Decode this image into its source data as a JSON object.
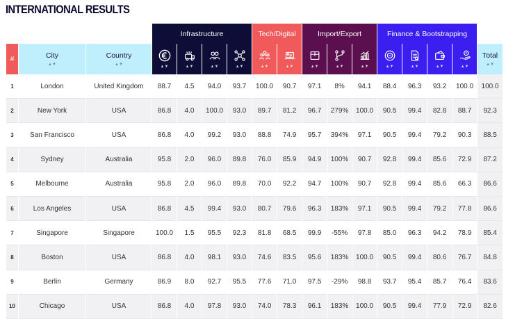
{
  "page": {
    "title": "INTERNATIONAL RESULTS"
  },
  "groups": {
    "infrastructure": "Infrastructure",
    "tech": "Tech/Digital",
    "import": "Import/Export",
    "finance": "Finance & Bootstrapping"
  },
  "columns": {
    "rank": "#",
    "city": "City",
    "country": "Country",
    "total": "Total",
    "icons": [
      "euro-icon",
      "transport-icon",
      "people-icon",
      "network-icon",
      "team-icon",
      "laptop-icon",
      "package-icon",
      "route-icon",
      "growth-chart-icon",
      "coin-icon",
      "document-icon",
      "wallet-icon",
      "hand-money-icon"
    ]
  },
  "colors": {
    "infrastructure": "#0d0d38",
    "tech": "#f05a5a",
    "import": "#5b0f4f",
    "finance": "#3a1ff0",
    "light_header": "#bfeefc"
  },
  "rows": [
    {
      "rank": "1",
      "city": "London",
      "country": "United Kingdom",
      "values": [
        "88.7",
        "4.5",
        "94.0",
        "93.7",
        "100.0",
        "90.7",
        "97.1",
        "8%",
        "94.1",
        "88.4",
        "96.3",
        "93.2",
        "100.0"
      ],
      "total": "100.0"
    },
    {
      "rank": "2",
      "city": "New York",
      "country": "USA",
      "values": [
        "86.8",
        "4.0",
        "100.0",
        "93.0",
        "89.7",
        "81.2",
        "96.7",
        "279%",
        "100.0",
        "90.5",
        "99.4",
        "82.8",
        "88.7"
      ],
      "total": "92.3"
    },
    {
      "rank": "3",
      "city": "San Francisco",
      "country": "USA",
      "values": [
        "86.8",
        "4.0",
        "99.2",
        "93.0",
        "88.8",
        "74.9",
        "95.7",
        "394%",
        "97.1",
        "90.5",
        "99.4",
        "79.2",
        "90.3"
      ],
      "total": "88.5"
    },
    {
      "rank": "4",
      "city": "Sydney",
      "country": "Australia",
      "values": [
        "95.8",
        "2.0",
        "96.0",
        "89.8",
        "76.0",
        "85.9",
        "94.9",
        "100%",
        "90.7",
        "92.8",
        "99.4",
        "85.6",
        "72.9"
      ],
      "total": "87.2"
    },
    {
      "rank": "5",
      "city": "Melbourne",
      "country": "Australia",
      "values": [
        "95.8",
        "2.0",
        "96.0",
        "89.8",
        "70.0",
        "92.2",
        "94.7",
        "100%",
        "90.7",
        "92.8",
        "99.4",
        "85.6",
        "66.3"
      ],
      "total": "86.6"
    },
    {
      "rank": "6",
      "city": "Los Angeles",
      "country": "USA",
      "values": [
        "86.8",
        "4.5",
        "99.4",
        "93.0",
        "80.7",
        "79.6",
        "96.3",
        "183%",
        "97.1",
        "90.5",
        "99.4",
        "79.2",
        "77.8"
      ],
      "total": "86.6"
    },
    {
      "rank": "7",
      "city": "Singapore",
      "country": "Singapore",
      "values": [
        "100.0",
        "1.5",
        "95.5",
        "92.3",
        "81.8",
        "68.5",
        "99.9",
        "-55%",
        "97.8",
        "85.0",
        "96.3",
        "94.2",
        "78.9"
      ],
      "total": "85.4"
    },
    {
      "rank": "8",
      "city": "Boston",
      "country": "USA",
      "values": [
        "86.8",
        "4.0",
        "98.1",
        "93.0",
        "74.6",
        "83.5",
        "95.6",
        "183%",
        "100.0",
        "90.5",
        "99.4",
        "80.6",
        "76.7"
      ],
      "total": "84.8"
    },
    {
      "rank": "9",
      "city": "Berlin",
      "country": "Germany",
      "values": [
        "86.9",
        "8.0",
        "92.7",
        "95.5",
        "77.6",
        "71.0",
        "97.5",
        "-29%",
        "98.8",
        "93.7",
        "95.4",
        "85.7",
        "76.4"
      ],
      "total": "83.6"
    },
    {
      "rank": "10",
      "city": "Chicago",
      "country": "USA",
      "values": [
        "86.8",
        "4.0",
        "97.8",
        "93.0",
        "74.0",
        "78.3",
        "96.1",
        "183%",
        "100.0",
        "90.5",
        "99.4",
        "77.9",
        "72.9"
      ],
      "total": "82.6"
    }
  ]
}
